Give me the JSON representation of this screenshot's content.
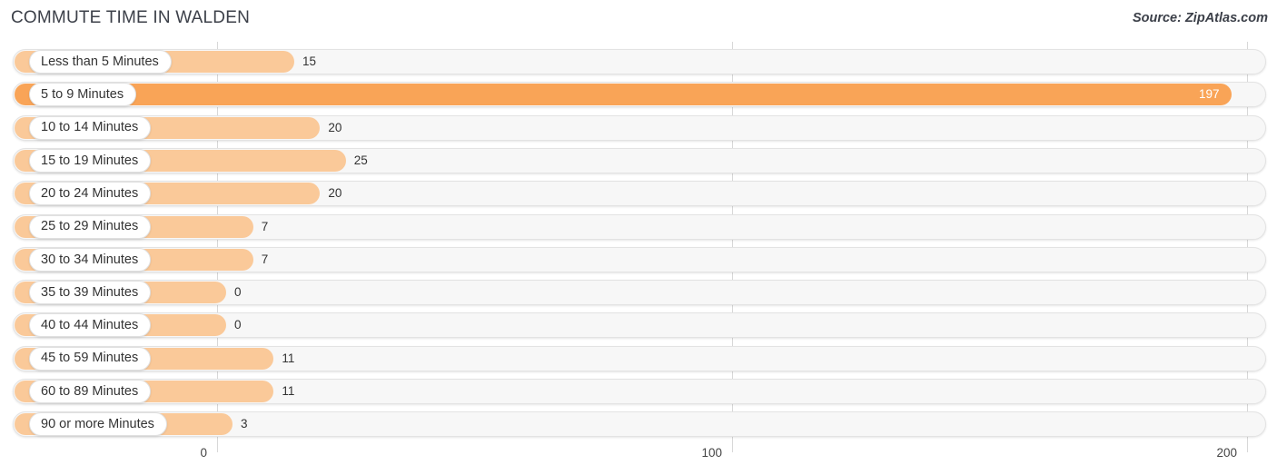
{
  "header": {
    "title": "COMMUTE TIME IN WALDEN",
    "source": "Source: ZipAtlas.com"
  },
  "colors": {
    "bar": "#FAC999",
    "bar_highlight": "#F9A457",
    "track": "#F7F7F7",
    "track_border": "#E3E3E3",
    "gridline": "#D8D8D8",
    "text": "#333333",
    "title_text": "#3C4049"
  },
  "chart_data": {
    "type": "bar",
    "orientation": "horizontal",
    "title": "COMMUTE TIME IN WALDEN",
    "xlabel": "",
    "ylabel": "",
    "xlim": [
      0,
      200
    ],
    "xticks": [
      0,
      100,
      200
    ],
    "xtick_labels": [
      "0",
      "100",
      "200"
    ],
    "grid": true,
    "legend": false,
    "categories": [
      "Less than 5 Minutes",
      "5 to 9 Minutes",
      "10 to 14 Minutes",
      "15 to 19 Minutes",
      "20 to 24 Minutes",
      "25 to 29 Minutes",
      "30 to 34 Minutes",
      "35 to 39 Minutes",
      "40 to 44 Minutes",
      "45 to 59 Minutes",
      "60 to 89 Minutes",
      "90 or more Minutes"
    ],
    "values": [
      15,
      197,
      20,
      25,
      20,
      7,
      7,
      0,
      0,
      11,
      11,
      3
    ],
    "value_labels": [
      "15",
      "197",
      "20",
      "25",
      "20",
      "7",
      "7",
      "0",
      "0",
      "11",
      "11",
      "3"
    ],
    "highlight_index": 1
  }
}
